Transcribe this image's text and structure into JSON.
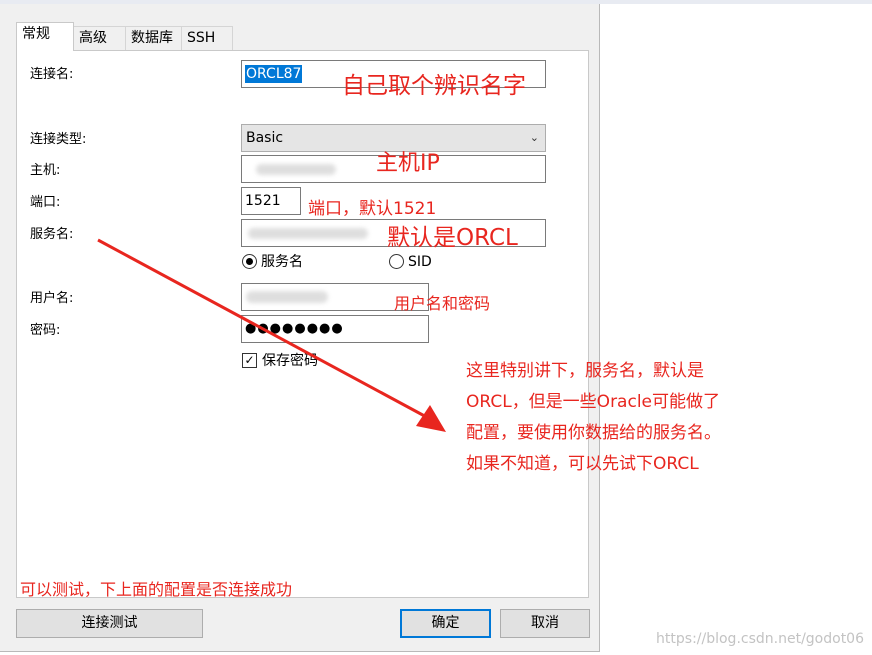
{
  "tabs": [
    {
      "label": "常规",
      "active": true
    },
    {
      "label": "高级",
      "active": false
    },
    {
      "label": "数据库",
      "active": false
    },
    {
      "label": "SSH",
      "active": false
    }
  ],
  "form": {
    "conn_name_label": "连接名:",
    "conn_name_value": "ORCL87",
    "conn_type_label": "连接类型:",
    "conn_type_value": "Basic",
    "host_label": "主机:",
    "port_label": "端口:",
    "port_value": "1521",
    "service_label": "服务名:",
    "radio_service": "服务名",
    "radio_sid": "SID",
    "user_label": "用户名:",
    "password_label": "密码:",
    "password_value": "●●●●●●●●",
    "save_password_label": "保存密码",
    "save_password_checked": "✓"
  },
  "buttons": {
    "test": "连接测试",
    "ok": "确定",
    "cancel": "取消"
  },
  "annotations": {
    "name_hint": "自己取个辨识名字",
    "host_hint": "主机IP",
    "port_hint": "端口，默认1521",
    "service_hint": "默认是ORCL",
    "user_hint": "用户名和密码",
    "test_hint": "可以测试，下上面的配置是否连接成功",
    "note_lines": [
      "这里特别讲下，服务名，默认是",
      "ORCL，但是一些Oracle可能做了",
      "配置，要使用你数据给的服务名。",
      "如果不知道，可以先试下ORCL"
    ]
  },
  "watermark": "https://blog.csdn.net/godot06",
  "colors": {
    "annotation": "#e8261f",
    "selection": "#0078d7",
    "primary_border": "#0078d7"
  },
  "icons": {
    "dropdown": "chevron-down-icon",
    "check": "checkmark-icon"
  }
}
